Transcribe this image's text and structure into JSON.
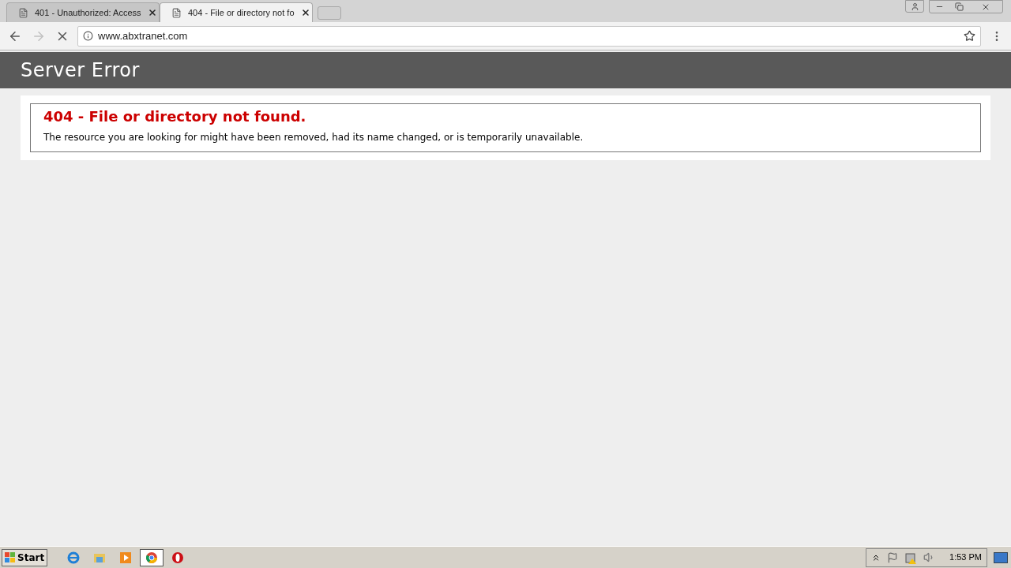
{
  "tabs": [
    {
      "title": "401 - Unauthorized: Access",
      "selected": false
    },
    {
      "title": "404 - File or directory not fo",
      "selected": true
    }
  ],
  "address_bar": {
    "url": "www.abxtranet.com"
  },
  "page": {
    "header": "Server Error",
    "error_title": "404 - File or directory not found.",
    "error_message": "The resource you are looking for might have been removed, had its name changed, or is temporarily unavailable."
  },
  "taskbar": {
    "start": "Start",
    "apps": [
      {
        "kind": "ie",
        "selected": false
      },
      {
        "kind": "explorer",
        "selected": false
      },
      {
        "kind": "media",
        "selected": false
      },
      {
        "kind": "chrome",
        "selected": true
      },
      {
        "kind": "opera",
        "selected": false
      }
    ],
    "clock": "1:53 PM"
  }
}
